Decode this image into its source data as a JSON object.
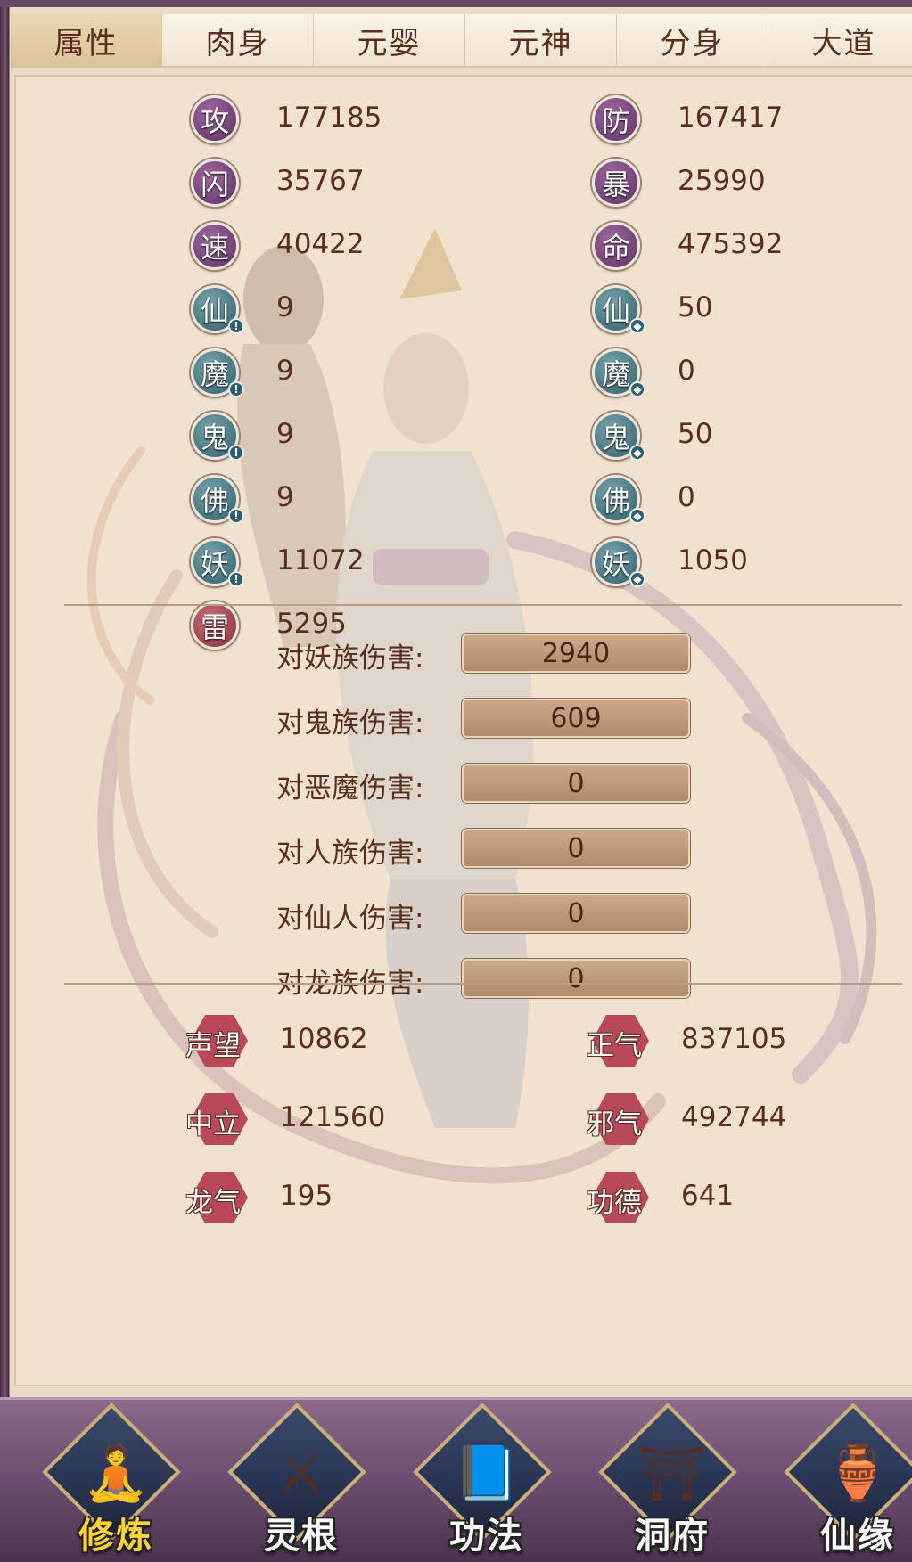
{
  "tabs": [
    "属性",
    "肉身",
    "元婴",
    "元神",
    "分身",
    "大道"
  ],
  "stats_left": [
    {
      "label": "攻",
      "value": "177185",
      "style": "purple",
      "mark": ""
    },
    {
      "label": "闪",
      "value": "35767",
      "style": "purple",
      "mark": ""
    },
    {
      "label": "速",
      "value": "40422",
      "style": "purple",
      "mark": ""
    },
    {
      "label": "仙",
      "value": "9",
      "style": "teal",
      "mark": "!"
    },
    {
      "label": "魔",
      "value": "9",
      "style": "teal",
      "mark": "!"
    },
    {
      "label": "鬼",
      "value": "9",
      "style": "teal",
      "mark": "!"
    },
    {
      "label": "佛",
      "value": "9",
      "style": "teal",
      "mark": "!"
    },
    {
      "label": "妖",
      "value": "11072",
      "style": "teal",
      "mark": "!"
    },
    {
      "label": "雷",
      "value": "5295",
      "style": "red",
      "mark": ""
    }
  ],
  "stats_right": [
    {
      "label": "防",
      "value": "167417",
      "style": "purple",
      "mark": ""
    },
    {
      "label": "暴",
      "value": "25990",
      "style": "purple",
      "mark": ""
    },
    {
      "label": "命",
      "value": "475392",
      "style": "purple",
      "mark": ""
    },
    {
      "label": "仙",
      "value": "50",
      "style": "teal",
      "mark": "shield"
    },
    {
      "label": "魔",
      "value": "0",
      "style": "teal",
      "mark": "shield"
    },
    {
      "label": "鬼",
      "value": "50",
      "style": "teal",
      "mark": "shield"
    },
    {
      "label": "佛",
      "value": "0",
      "style": "teal",
      "mark": "shield"
    },
    {
      "label": "妖",
      "value": "1050",
      "style": "teal",
      "mark": "shield"
    }
  ],
  "damage": [
    {
      "label": "对妖族伤害:",
      "value": "2940"
    },
    {
      "label": "对鬼族伤害:",
      "value": "609"
    },
    {
      "label": "对恶魔伤害:",
      "value": "0"
    },
    {
      "label": "对人族伤害:",
      "value": "0"
    },
    {
      "label": "对仙人伤害:",
      "value": "0"
    },
    {
      "label": "对龙族伤害:",
      "value": "0"
    }
  ],
  "reputation": [
    {
      "label": "声望",
      "value": "10862"
    },
    {
      "label": "正气",
      "value": "837105"
    },
    {
      "label": "中立",
      "value": "121560"
    },
    {
      "label": "邪气",
      "value": "492744"
    },
    {
      "label": "龙气",
      "value": "195"
    },
    {
      "label": "功德",
      "value": "641"
    }
  ],
  "nav": [
    {
      "label": "修炼",
      "icon": "monk-icon",
      "highlight": true
    },
    {
      "label": "灵根",
      "icon": "sword-icon",
      "highlight": false
    },
    {
      "label": "功法",
      "icon": "book-icon",
      "highlight": false
    },
    {
      "label": "洞府",
      "icon": "pagoda-icon",
      "highlight": false
    },
    {
      "label": "仙缘",
      "icon": "gourd-icon",
      "highlight": false
    }
  ]
}
